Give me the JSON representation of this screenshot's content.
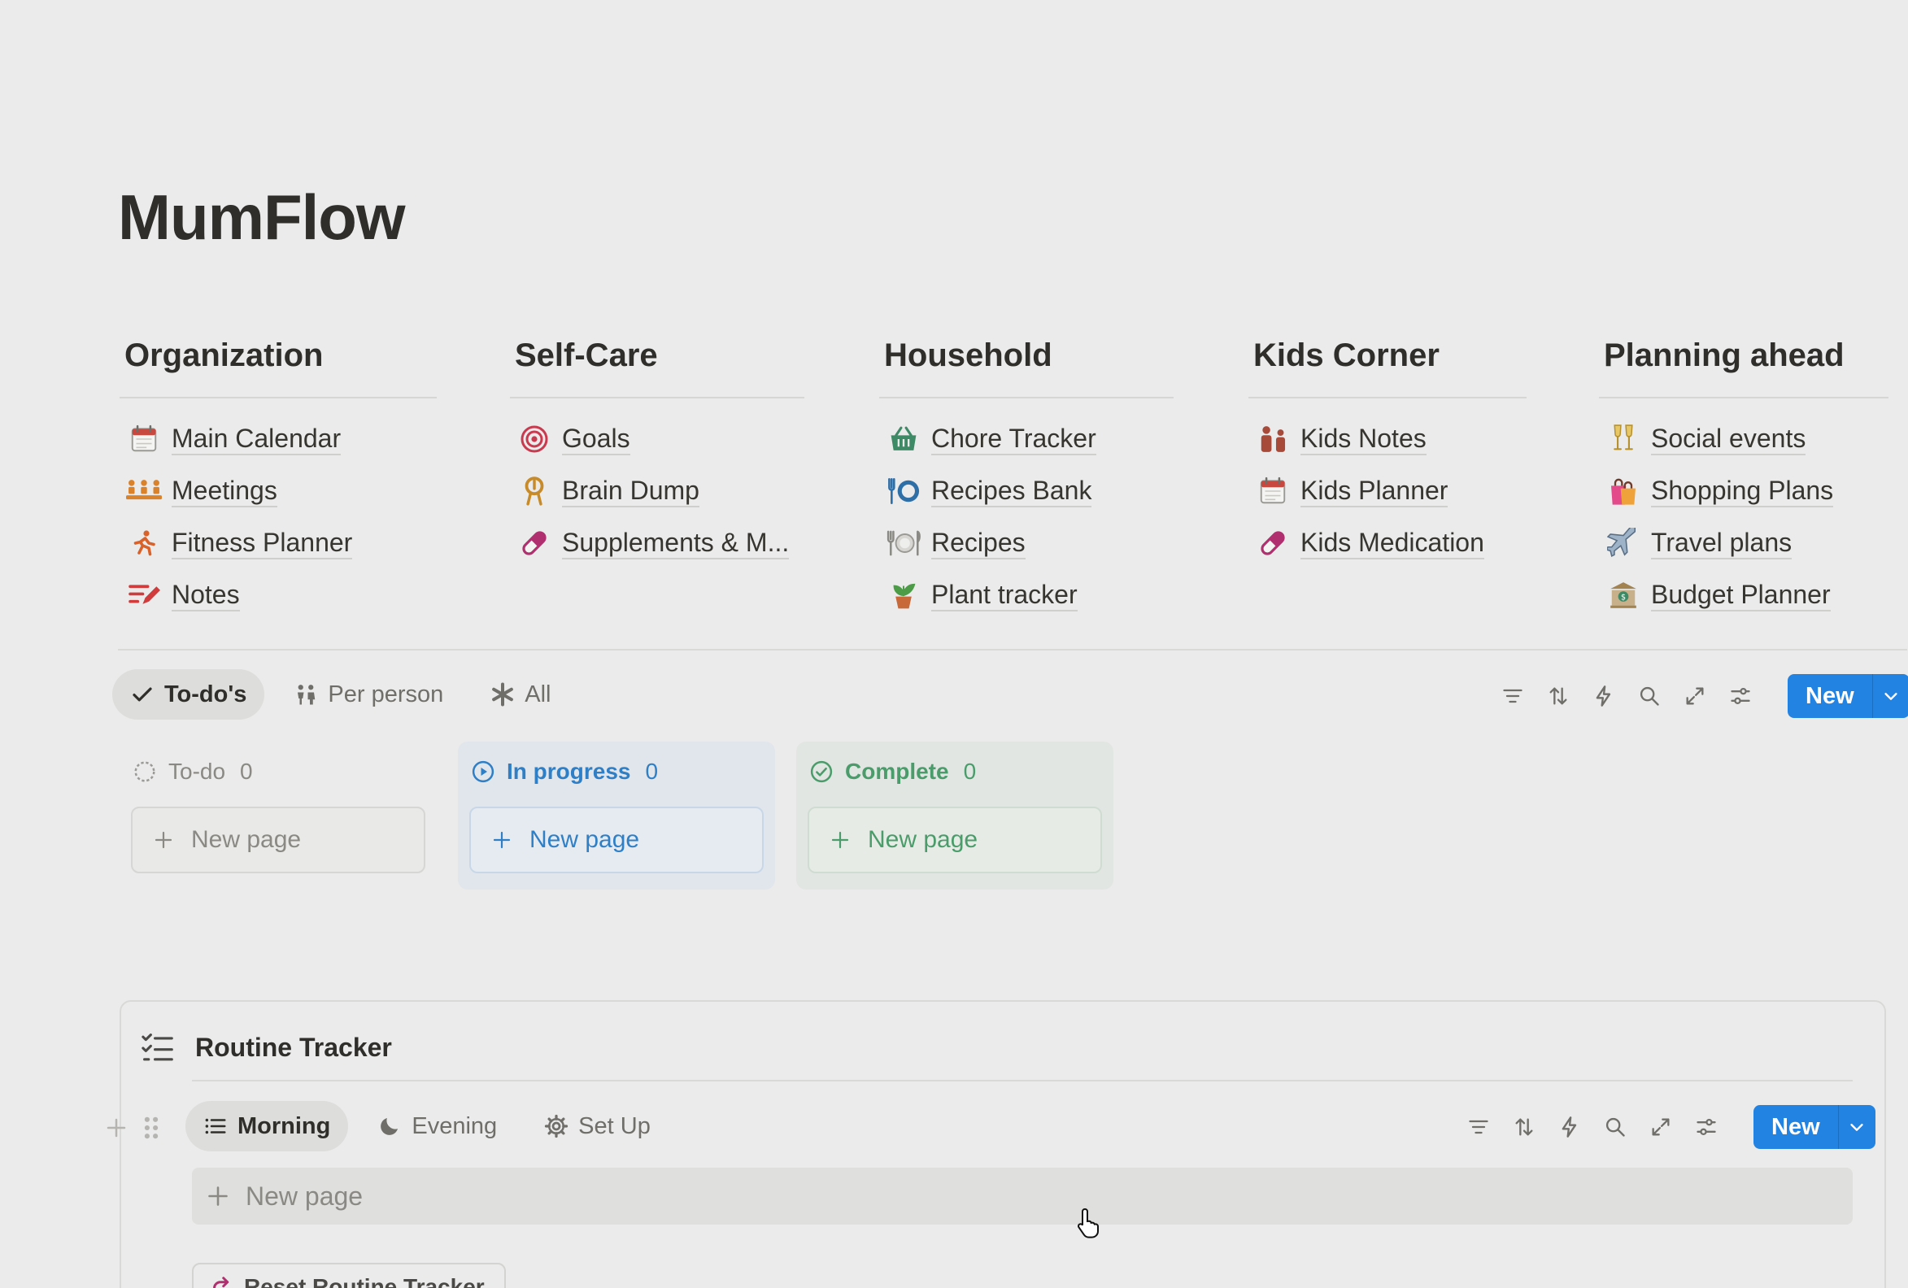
{
  "page": {
    "title": "MumFlow"
  },
  "nav": [
    {
      "heading": "Organization",
      "items": [
        {
          "icon": "calendar-icon",
          "label": "Main Calendar"
        },
        {
          "icon": "meeting-icon",
          "label": "Meetings"
        },
        {
          "icon": "running-icon",
          "label": "Fitness Planner"
        },
        {
          "icon": "notes-icon",
          "label": "Notes"
        }
      ]
    },
    {
      "heading": "Self-Care",
      "items": [
        {
          "icon": "target-icon",
          "label": "Goals"
        },
        {
          "icon": "brain-icon",
          "label": "Brain Dump"
        },
        {
          "icon": "pill-icon",
          "label": "Supplements & M..."
        }
      ]
    },
    {
      "heading": "Household",
      "items": [
        {
          "icon": "basket-icon",
          "label": "Chore Tracker"
        },
        {
          "icon": "fork-plate-icon",
          "label": "Recipes Bank"
        },
        {
          "icon": "plate-icon",
          "label": "Recipes"
        },
        {
          "icon": "plant-icon",
          "label": "Plant tracker"
        }
      ]
    },
    {
      "heading": "Kids Corner",
      "items": [
        {
          "icon": "kids-icon",
          "label": "Kids Notes"
        },
        {
          "icon": "calendar-icon",
          "label": "Kids Planner"
        },
        {
          "icon": "pill-icon",
          "label": "Kids Medication"
        }
      ]
    },
    {
      "heading": "Planning ahead",
      "items": [
        {
          "icon": "glasses-icon",
          "label": "Social events"
        },
        {
          "icon": "shopping-bags-icon",
          "label": "Shopping Plans"
        },
        {
          "icon": "airplane-icon",
          "label": "Travel plans"
        },
        {
          "icon": "bank-icon",
          "label": "Budget Planner"
        }
      ]
    }
  ],
  "todo_view": {
    "tabs": [
      {
        "label": "To-do's",
        "icon": "check-icon",
        "active": true
      },
      {
        "label": "Per person",
        "icon": "people-icon",
        "active": false
      },
      {
        "label": "All",
        "icon": "asterisk-icon",
        "active": false
      }
    ],
    "new_label": "New",
    "columns": [
      {
        "name": "To-do",
        "count": "0",
        "icon": "circle-dashed-icon",
        "color": "#8a8984",
        "bg": "#e3e3e1",
        "card_bg": "#e9e9e7",
        "card_border": "#d6d6d4",
        "new_label": "New page"
      },
      {
        "name": "In progress",
        "count": "0",
        "icon": "play-circle-icon",
        "color": "#2f7fc7",
        "bg": "#e1e6ec",
        "card_bg": "#e6ebf1",
        "card_border": "#c8d7e8",
        "new_label": "New page"
      },
      {
        "name": "Complete",
        "count": "0",
        "icon": "check-circle-icon",
        "color": "#4a9c6a",
        "bg": "#e2e6e2",
        "card_bg": "#e6ebe6",
        "card_border": "#cfdcd2",
        "new_label": "New page"
      }
    ]
  },
  "routine": {
    "title": "Routine Tracker",
    "tabs": [
      {
        "label": "Morning",
        "icon": "list-icon",
        "active": true
      },
      {
        "label": "Evening",
        "icon": "moon-icon",
        "active": false
      },
      {
        "label": "Set Up",
        "icon": "gear-icon",
        "active": false
      }
    ],
    "new_label": "New",
    "new_page_label": "New page",
    "reset_label": "Reset Routine Tracker"
  },
  "colors": {
    "accent": "#2383e2",
    "background": "#ebebeb"
  }
}
